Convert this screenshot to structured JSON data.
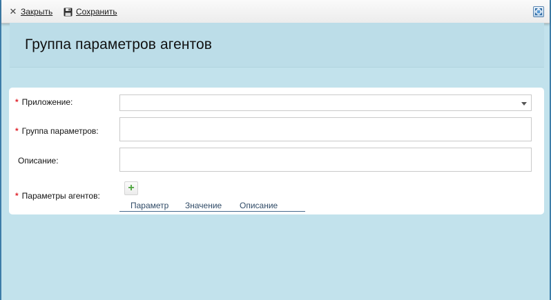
{
  "toolbar": {
    "close_label": "Закрыть",
    "save_label": "Сохранить",
    "close_icon": "close-icon",
    "save_icon": "floppy-disk-icon",
    "corner_icon": "window-resize-icon"
  },
  "header": {
    "title": "Группа параметров агентов"
  },
  "form": {
    "required_marker": "*",
    "application": {
      "label": "Приложение:",
      "value": ""
    },
    "parameter_group": {
      "label": "Группа параметров:",
      "value": ""
    },
    "description": {
      "label": "Описание:",
      "value": ""
    },
    "agent_parameters": {
      "label": "Параметры агентов:",
      "add_icon": "plus-icon",
      "columns": [
        "Параметр",
        "Значение",
        "Описание"
      ],
      "rows": []
    }
  },
  "colors": {
    "background": "#c2e2ec",
    "header_band": "#bcdde8",
    "required": "#e0262e",
    "add_plus": "#4aa33a",
    "grid_header_text": "#2f4a66"
  }
}
